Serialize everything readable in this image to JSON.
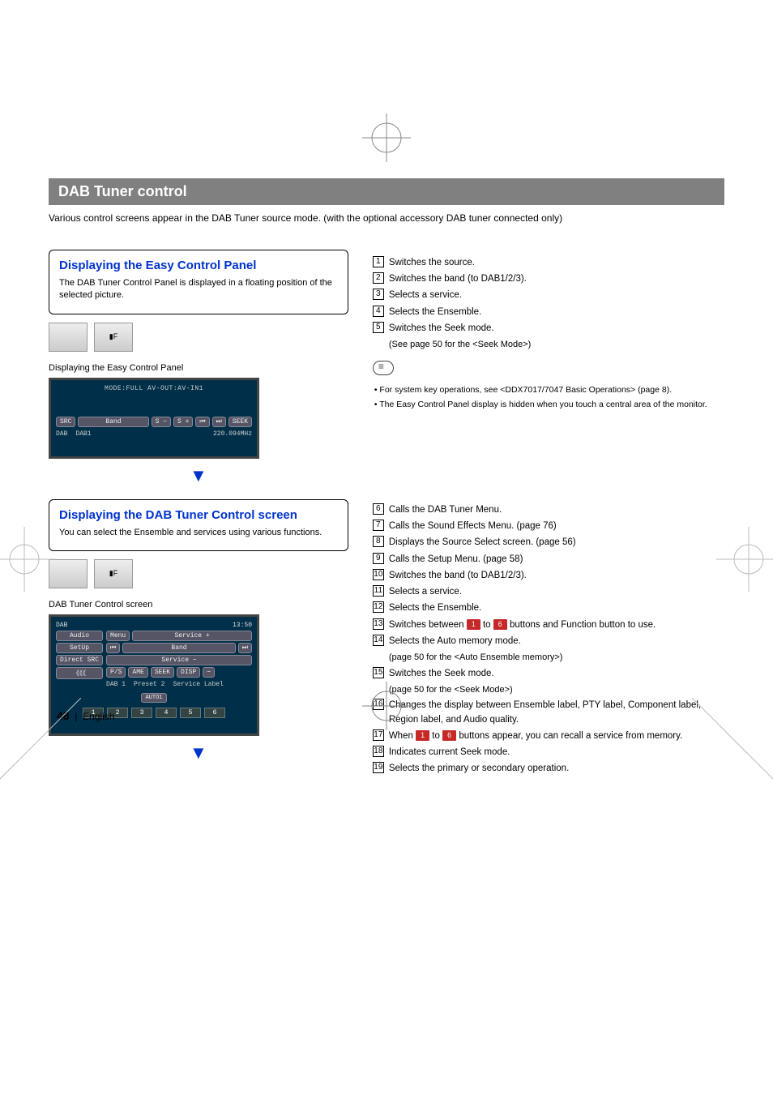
{
  "header": "DAB Tuner control",
  "intro": "Various control screens appear in the DAB Tuner source mode. (with the optional accessory DAB tuner connected only)",
  "section1": {
    "title": "Displaying the Easy Control Panel",
    "sub": "The DAB Tuner Control Panel is displayed in a floating position of the selected picture.",
    "screen_label": "Displaying the Easy Control Panel",
    "sim": {
      "mode_line": "MODE:FULL  AV-OUT:AV-IN1",
      "btn_src": "SRC",
      "src_name": "DAB",
      "btn_band": "Band",
      "band_val": "DAB1",
      "btn_s_minus": "S −",
      "btn_s_plus": "S +",
      "btn_prev": "⏮",
      "btn_next": "⏭",
      "btn_seek": "SEEK",
      "freq": "220.094MHz"
    }
  },
  "easy_desc": {
    "1": "Switches the source.",
    "2": "Switches the band (to DAB1/2/3).",
    "3": "Selects a service.",
    "4": "Selects the Ensemble.",
    "5": "Switches the Seek mode.",
    "5b": "(See page 50 for the <Seek Mode>)"
  },
  "easy_notes": [
    "For system key operations, see <DDX7017/7047 Basic Operations> (page 8).",
    "The Easy Control Panel display is hidden when you touch a central area of the monitor."
  ],
  "section2": {
    "title": "Displaying the DAB Tuner Control screen",
    "sub": "You can select the Ensemble and services using various functions.",
    "screen_label": "DAB Tuner Control screen",
    "sim": {
      "toprow_src": "DAB",
      "toprow_time": "13:50",
      "btn_audio": "Audio",
      "btn_menu": "Menu",
      "btn_setup": "SetUp",
      "btn_direct": "Direct SRC",
      "btn_fold": "《《《",
      "btn_serv_plus": "Service +",
      "btn_serv_minus": "Service −",
      "btn_band": "Band",
      "btn_prev": "⏮",
      "btn_next": "⏭",
      "btn_ps": "P/S",
      "btn_ame": "AME",
      "btn_seek": "SEEK",
      "btn_disp": "DISP",
      "btn_minus": "−",
      "seek_ind": "AUTO1",
      "info_band": "DAB 1",
      "info_preset": "Preset 2",
      "info_service": "Service Label",
      "presets": [
        "1",
        "2",
        "3",
        "4",
        "5",
        "6"
      ]
    }
  },
  "dab_desc": {
    "6": "Calls the DAB Tuner Menu.",
    "7": "Calls the Sound Effects Menu. (page 76)",
    "8": "Displays the Source Select screen. (page 56)",
    "9": "Calls the Setup Menu. (page 58)",
    "10": "Switches the band (to DAB1/2/3).",
    "11": "Selects a service.",
    "12": "Selects the Ensemble.",
    "13a": "Switches between ",
    "13b": " to ",
    "13c": " buttons and Function button to use.",
    "14": "Selects the Auto memory mode.",
    "14b": "(page 50 for the <Auto Ensemble memory>)",
    "15": "Switches the Seek mode.",
    "15b": "(page 50 for the <Seek Mode>)",
    "16": "Changes the display between Ensemble label, PTY label, Component label, Region label, and Audio quality.",
    "17a": "When ",
    "17b": " to ",
    "17c": " buttons appear, you can recall a service from memory.",
    "18": "Indicates current Seek mode.",
    "19": "Selects the primary or secondary operation."
  },
  "preset_tokens": {
    "p1": "1",
    "p6": "6"
  },
  "footer": {
    "page": "48",
    "sep": "|",
    "lang": "English"
  }
}
